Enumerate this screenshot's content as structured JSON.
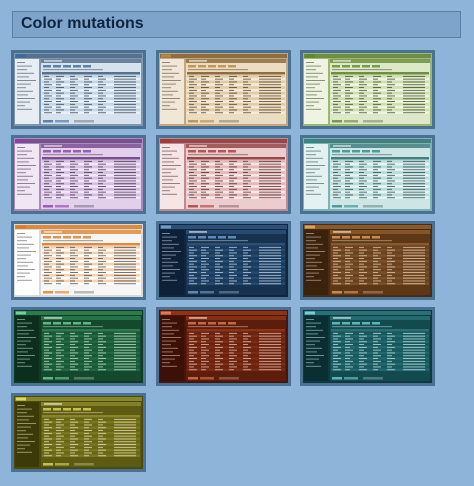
{
  "page": {
    "title": "Color mutations"
  },
  "tiles": [
    {
      "name": "theme-slate-blue",
      "bg": "#7e98b0",
      "sidebar": "#e7edf3",
      "content": "#d6e2ec",
      "header": "#56718e",
      "accent": "#3a6b9a",
      "row": "#c3d6e8",
      "row_alt": "#e9f0f7",
      "text": "#1c2c3c",
      "dark": false
    },
    {
      "name": "theme-sand",
      "bg": "#c2a882",
      "sidebar": "#f1e7d6",
      "content": "#ecdcc1",
      "header": "#8f6d3f",
      "accent": "#b8863f",
      "row": "#e3cca5",
      "row_alt": "#f4ead8",
      "text": "#3a2a14",
      "dark": false
    },
    {
      "name": "theme-olive-green",
      "bg": "#9cb774",
      "sidebar": "#eef3e2",
      "content": "#dde8c8",
      "header": "#6f8f40",
      "accent": "#5f8a2a",
      "row": "#cfe0b0",
      "row_alt": "#eef4e2",
      "text": "#25340f",
      "dark": false
    },
    {
      "name": "theme-lavender",
      "bg": "#a98ab8",
      "sidebar": "#f0e6f4",
      "content": "#e2d0ea",
      "header": "#7a4f92",
      "accent": "#8a3fa8",
      "row": "#d6bfe2",
      "row_alt": "#f1e7f6",
      "text": "#2e1a3a",
      "dark": false
    },
    {
      "name": "theme-rose",
      "bg": "#c08a8a",
      "sidebar": "#f5e5e5",
      "content": "#eccccc",
      "header": "#964848",
      "accent": "#a83838",
      "row": "#e4b8b8",
      "row_alt": "#f6e6e6",
      "text": "#3d1616",
      "dark": false
    },
    {
      "name": "theme-teal",
      "bg": "#7fb2b2",
      "sidebar": "#e4f1f1",
      "content": "#cde5e5",
      "header": "#437f80",
      "accent": "#2d8a8a",
      "row": "#b8dbdb",
      "row_alt": "#e6f3f3",
      "text": "#123434",
      "dark": false
    },
    {
      "name": "theme-light-orange",
      "bg": "#d9d9d9",
      "sidebar": "#ffffff",
      "content": "#f6f6f6",
      "header": "#e08a3c",
      "accent": "#e07a20",
      "row": "#f7d2ad",
      "row_alt": "#ffffff",
      "text": "#333333",
      "dark": false
    },
    {
      "name": "theme-navy-dark",
      "bg": "#10263e",
      "sidebar": "#0d2036",
      "content": "#16324f",
      "header": "#2c5078",
      "accent": "#6f9fd0",
      "row": "#1c3c5e",
      "row_alt": "#244a70",
      "text": "#d7e6f5",
      "dark": true
    },
    {
      "name": "theme-brown-dark",
      "bg": "#4a2c12",
      "sidebar": "#3b220d",
      "content": "#5c3816",
      "header": "#8a5a2a",
      "accent": "#e0a060",
      "row": "#6a4320",
      "row_alt": "#7a5028",
      "text": "#f3dcc0",
      "dark": true
    },
    {
      "name": "theme-green-dark",
      "bg": "#0f3a24",
      "sidebar": "#0c2f1d",
      "content": "#15492d",
      "header": "#2e7a4f",
      "accent": "#74d09a",
      "row": "#1b5a37",
      "row_alt": "#226942",
      "text": "#d6f0df",
      "dark": true
    },
    {
      "name": "theme-maroon-dark",
      "bg": "#4a1508",
      "sidebar": "#3b1006",
      "content": "#5c1d0c",
      "header": "#8a3418",
      "accent": "#e07a50",
      "row": "#6a2410",
      "row_alt": "#7a2c16",
      "text": "#f5d5c5",
      "dark": true
    },
    {
      "name": "theme-deep-teal-dark",
      "bg": "#0e3a3e",
      "sidebar": "#0a2f32",
      "content": "#134a4e",
      "header": "#2a7076",
      "accent": "#6fd0d6",
      "row": "#1a5a5f",
      "row_alt": "#22686e",
      "text": "#d6f0f2",
      "dark": true
    },
    {
      "name": "theme-olive-dark",
      "bg": "#4c4a0c",
      "sidebar": "#3c3b08",
      "content": "#5d5b12",
      "header": "#8a872a",
      "accent": "#e0d860",
      "row": "#6a6818",
      "row_alt": "#7a781e",
      "text": "#f2f0c8",
      "dark": true
    }
  ]
}
